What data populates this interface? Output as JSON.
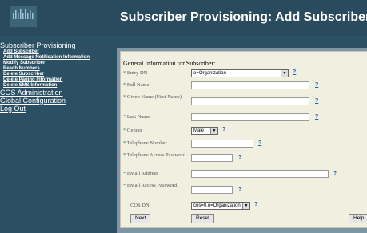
{
  "page_title": "Subscriber Provisioning: Add Subscriber",
  "sidebar": {
    "section1": "Subscriber Provisioning",
    "subitems": [
      "Add Subscriber",
      "Add Message Notification Information",
      "Modify Subscriber",
      "Reach Numbers",
      "Delete Subscriber",
      "Delete Paging Information",
      "Delete SMS Information"
    ],
    "section2": "COS Administration",
    "section3": "Global Configuration",
    "section4": "Log Out"
  },
  "form": {
    "section_title": "General Information for Subscriber:",
    "required_mark": "*",
    "help_text": "?",
    "entry_dn_label": "Entry DN",
    "entry_dn_value": "o=Organization",
    "full_name_label": "Full Name",
    "given_name_label": "Given Name (First Name)",
    "last_name_label": "Last Name",
    "gender_label": "Gender",
    "gender_value": "Male",
    "telephone_label": "Telephone Number",
    "telephone_access_label": "Telephone Access Password",
    "email_label": "EMail Address",
    "email_access_label": "EMail Access Password",
    "cos_dn_label": "COS DN",
    "cos_dn_value": "cos=0,o=Organization"
  },
  "buttons": {
    "next": "Next",
    "reset": "Reset",
    "help": "Help"
  },
  "colors": {
    "background": "#2b4f63",
    "panel": "#f1efe0",
    "required": "#2e8b57"
  }
}
